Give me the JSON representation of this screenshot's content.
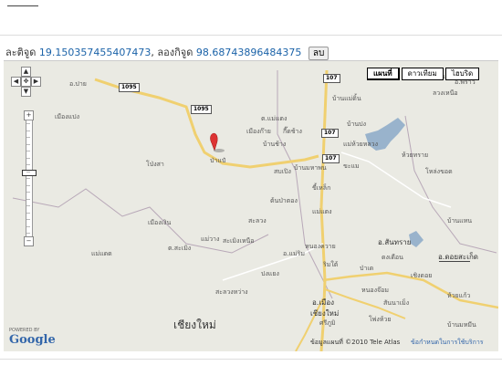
{
  "coords": {
    "lat_label": "ละติจูด",
    "lat_value": "19.150357455407473",
    "sep": ", ",
    "lng_label": "ลองกิจูด",
    "lng_value": "98.68743896484375",
    "delete_button": "ลบ"
  },
  "map_types": [
    "แผนที่",
    "ดาวเทียม",
    "ไฮบริด"
  ],
  "selected_map_type": "แผนที่",
  "zoom": {
    "levels": 17,
    "current": 9
  },
  "pan_icons": [
    "pan-up-icon",
    "pan-left-icon",
    "pan-center-icon",
    "pan-right-icon",
    "pan-down-icon"
  ],
  "zoom_in": "+",
  "zoom_out": "−",
  "route_shields": [
    "1095",
    "1095",
    "107",
    "107",
    "107"
  ],
  "places": [
    "อ.ปาย",
    "เมืองแปง",
    "ต.แม่แตง",
    "เมืองก๊าย",
    "กี๊ดช้าง",
    "บ้านช้าง",
    "ป่าแป๋",
    "โป่งสา",
    "บ้านมหาพน",
    "สบเปิง",
    "ขี้เหล็ก",
    "ต้นป่าตอง",
    "แม่แตง",
    "สะลวง",
    "ห้วยทราย",
    "เมืองเงิน",
    "แม่วาง",
    "ต.สะเมิง",
    "สะเมิงเหนือ",
    "อ.แม่ริม",
    "แม่แดด",
    "ปงแยง",
    "ริมใต้",
    "หนองควาย",
    "อ.เมือง",
    "เชียงใหม่",
    "ศรีภูมิ",
    "ป่าเด",
    "อ.สันทราย",
    "อ.ดอยสะเก็ด",
    "เชิงดอย",
    "ห้วยแก้ว",
    "ดงเดือน",
    "บ้านแม่ดิ้น",
    "อ.พร้าว",
    "โหล่งขอด",
    "บ้านแหน",
    "ลวงเหนือ",
    "หนองจ๊อม",
    "สันนาเม็ง",
    "บ้านมหมีน",
    "โพ่งห้วย",
    "แม่แก้วหม่ำ",
    "แม่ห้วยหลวง",
    "ขะแม",
    "บ้านปง",
    "สะลวงหว่าง"
  ],
  "big_label": "เชียงใหม่",
  "powered_by": "POWERED BY",
  "google": "Google",
  "copyright": "ข้อมูลแผนที่ ©2010 Tele Atlas",
  "terms": "ข้อกำหนดในการใช้บริการ"
}
